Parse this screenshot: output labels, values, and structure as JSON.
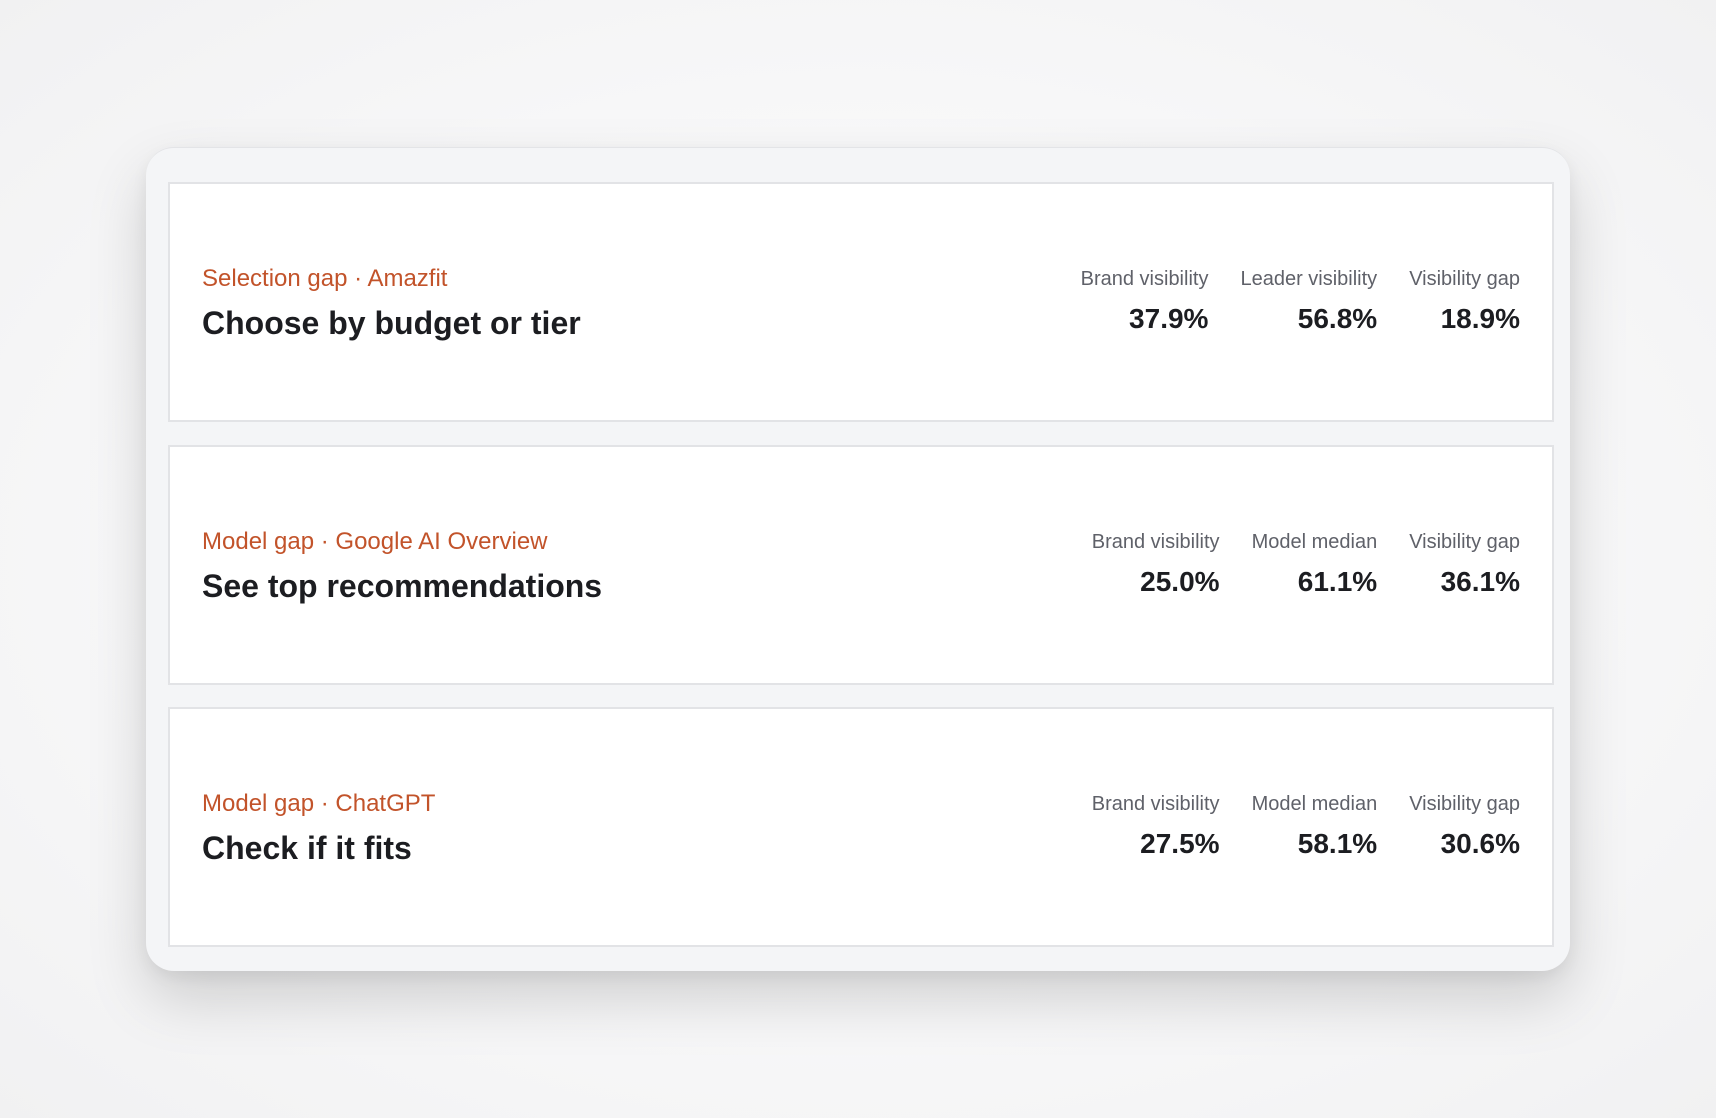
{
  "cards": [
    {
      "eyebrow": "Selection gap · Amazfit",
      "title": "Choose by budget or tier",
      "metrics": [
        {
          "label": "Brand visibility",
          "value": "37.9%"
        },
        {
          "label": "Leader visibility",
          "value": "56.8%"
        },
        {
          "label": "Visibility gap",
          "value": "18.9%"
        }
      ]
    },
    {
      "eyebrow": "Model gap · Google AI Overview",
      "title": "See top recommendations",
      "metrics": [
        {
          "label": "Brand visibility",
          "value": "25.0%"
        },
        {
          "label": "Model median",
          "value": "61.1%"
        },
        {
          "label": "Visibility gap",
          "value": "36.1%"
        }
      ]
    },
    {
      "eyebrow": "Model gap · ChatGPT",
      "title": "Check if it fits",
      "metrics": [
        {
          "label": "Brand visibility",
          "value": "27.5%"
        },
        {
          "label": "Model median",
          "value": "58.1%"
        },
        {
          "label": "Visibility gap",
          "value": "30.6%"
        }
      ]
    }
  ],
  "colors": {
    "accent": "#c2532a",
    "text": "#1c1d21",
    "muted": "#5f6169",
    "panel": "#f4f5f7",
    "card": "#ffffff",
    "border": "#e2e3e6"
  }
}
